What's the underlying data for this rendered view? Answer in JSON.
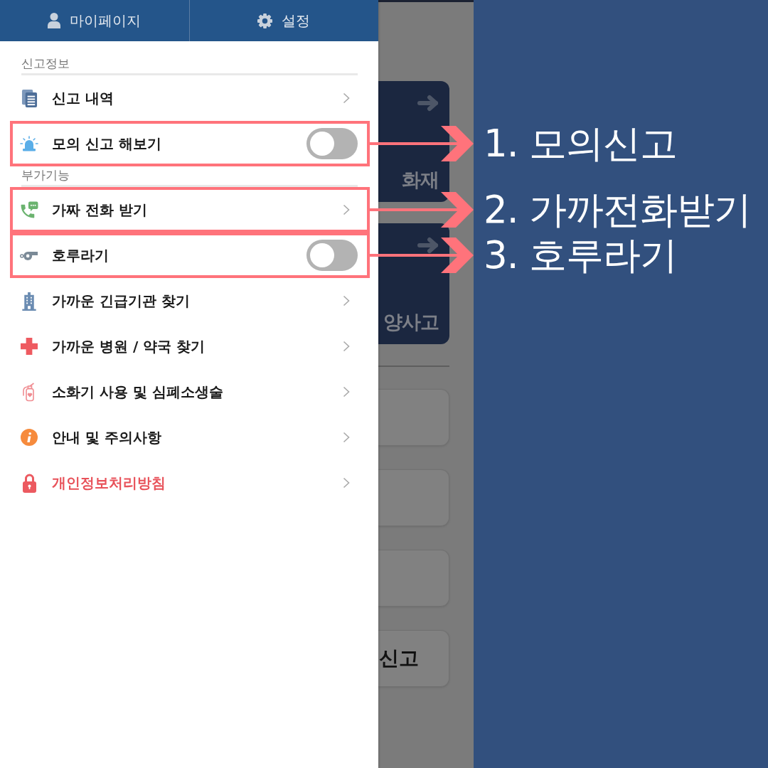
{
  "drawer": {
    "header_buttons": [
      {
        "label": "마이페이지"
      },
      {
        "label": "설정"
      }
    ],
    "sections": [
      {
        "title": "신고정보",
        "items": [
          {
            "label": "신고 내역",
            "kind": "link",
            "color": "#1a1a1a"
          },
          {
            "label": "모의 신고 해보기",
            "kind": "toggle",
            "on": false,
            "color": "#1a1a1a",
            "annotation": "1. 모의신고"
          }
        ]
      },
      {
        "title": "부가기능",
        "items": [
          {
            "label": "가짜 전화 받기",
            "kind": "link",
            "color": "#1a1a1a",
            "annotation": "2. 가까전화받기"
          },
          {
            "label": "호루라기",
            "kind": "toggle",
            "on": false,
            "color": "#1a1a1a",
            "annotation": "3. 호루라기"
          },
          {
            "label": "가까운 긴급기관 찾기",
            "kind": "link",
            "color": "#1a1a1a"
          },
          {
            "label": "가까운 병원 / 약국 찾기",
            "kind": "link",
            "color": "#1a1a1a"
          },
          {
            "label": "소화기 사용 및 심폐소생술",
            "kind": "link",
            "color": "#1a1a1a"
          },
          {
            "label": "안내 및 주의사항",
            "kind": "link",
            "color": "#1a1a1a"
          },
          {
            "label": "개인정보처리방침",
            "kind": "link",
            "color": "#e8525a"
          }
        ]
      }
    ]
  },
  "background_screen": {
    "cards": [
      {
        "label": "화재"
      },
      {
        "label": "양사고"
      }
    ],
    "buttons": [
      {
        "kind": "blank"
      },
      {
        "kind": "blank"
      },
      {
        "kind": "blank"
      },
      {
        "kind": "labeled",
        "label": "신고"
      }
    ]
  }
}
